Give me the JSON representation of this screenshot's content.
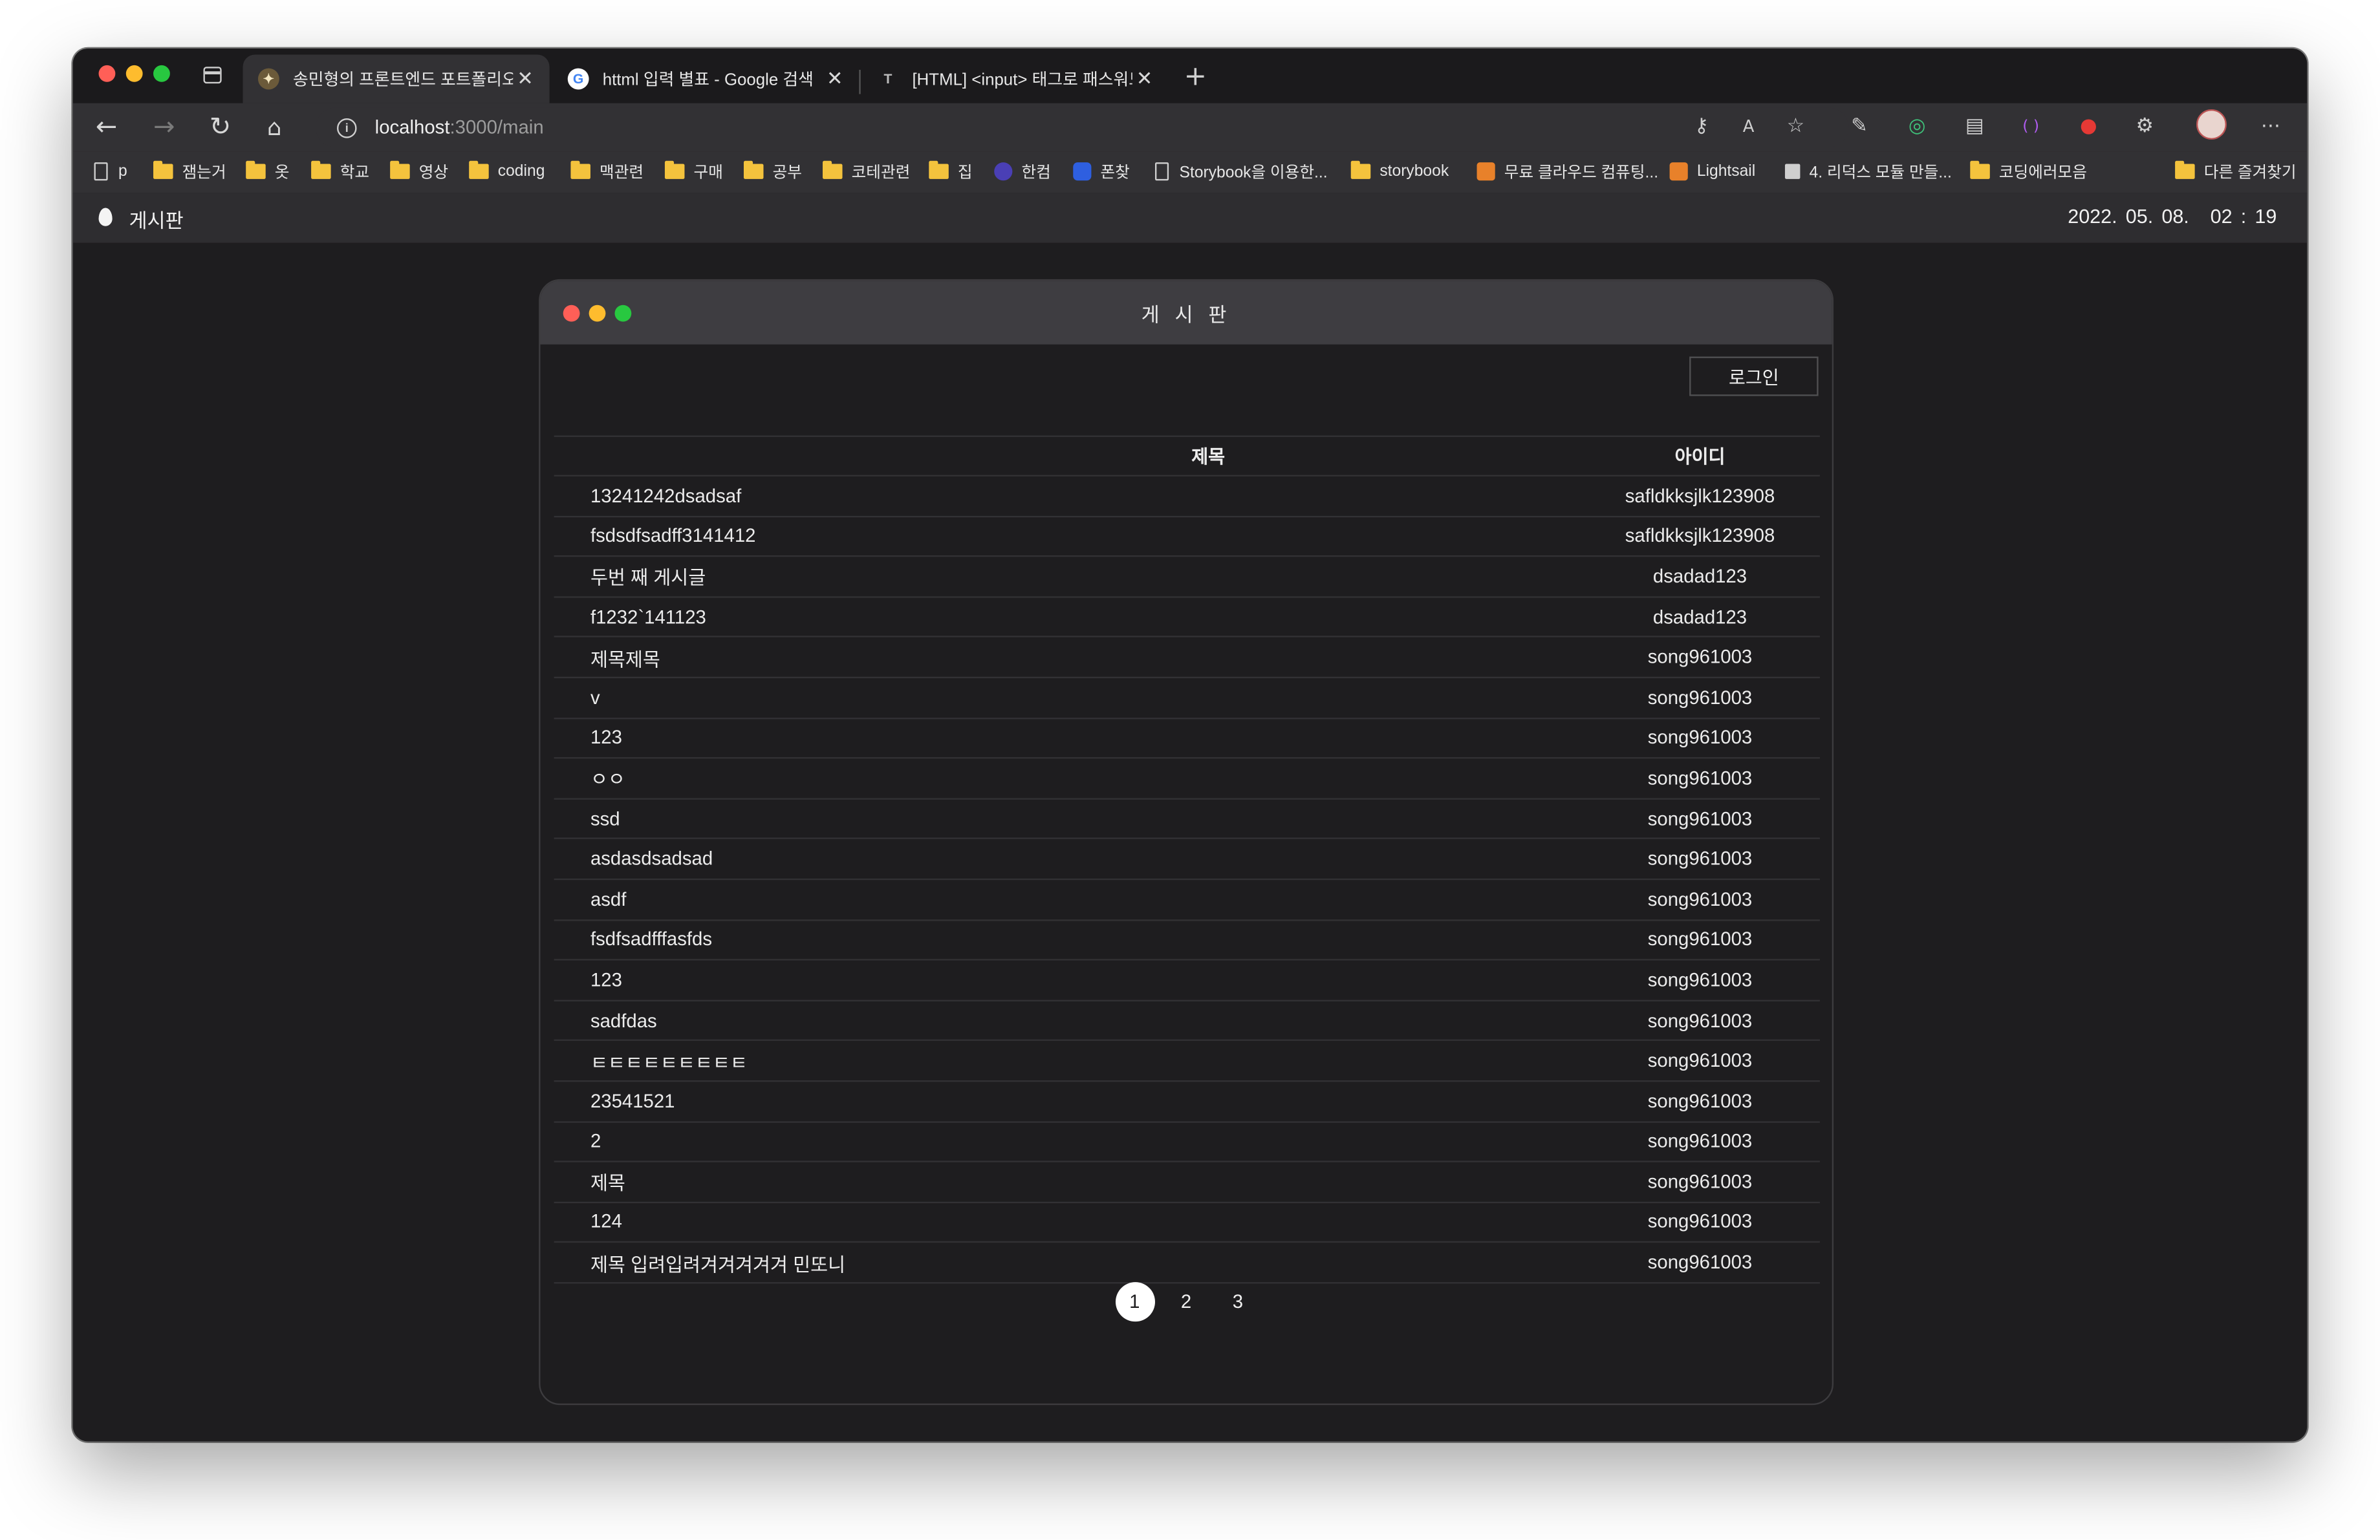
{
  "browser": {
    "tabs": [
      {
        "title": "송민형의 프론트엔드 포트폴리오",
        "active": true
      },
      {
        "title": "httml 입력 별표 - Google 검색",
        "active": false
      },
      {
        "title": "[HTML] <input> 태그로 패스워드",
        "active": false
      }
    ],
    "address": {
      "host": "localhost",
      "path": ":3000/main"
    },
    "bookmarks": [
      {
        "label": "p",
        "type": "page"
      },
      {
        "label": "잼는거",
        "type": "folder"
      },
      {
        "label": "옷",
        "type": "folder"
      },
      {
        "label": "학교",
        "type": "folder"
      },
      {
        "label": "영상",
        "type": "folder"
      },
      {
        "label": "coding",
        "type": "folder"
      },
      {
        "label": "맥관련",
        "type": "folder"
      },
      {
        "label": "구매",
        "type": "folder"
      },
      {
        "label": "공부",
        "type": "folder"
      },
      {
        "label": "코테관련",
        "type": "folder"
      },
      {
        "label": "집",
        "type": "folder"
      },
      {
        "label": "한컴",
        "type": "site"
      },
      {
        "label": "폰찾",
        "type": "site"
      },
      {
        "label": "Storybook을 이용한...",
        "type": "page"
      },
      {
        "label": "storybook",
        "type": "folder"
      },
      {
        "label": "무료 클라우드 컴퓨팅...",
        "type": "site"
      },
      {
        "label": "Lightsail",
        "type": "site"
      },
      {
        "label": "4. 리덕스 모듈 만들...",
        "type": "site"
      },
      {
        "label": "코딩에러모음",
        "type": "folder"
      }
    ],
    "other_bookmarks": "다른 즐겨찾기"
  },
  "app": {
    "title": "게시판",
    "date": "2022. 05. 08.",
    "time": "02 : 19"
  },
  "board": {
    "title": "게 시 판",
    "login_label": "로그인",
    "columns": {
      "title": "제목",
      "id": "아이디"
    },
    "rows": [
      {
        "title": "13241242dsadsaf",
        "id": "safldkksjlk123908"
      },
      {
        "title": "fsdsdfsadff3141412",
        "id": "safldkksjlk123908"
      },
      {
        "title": "두번 째 게시글",
        "id": "dsadad123"
      },
      {
        "title": "f1232`141123",
        "id": "dsadad123"
      },
      {
        "title": "제목제목",
        "id": "song961003"
      },
      {
        "title": "v",
        "id": "song961003"
      },
      {
        "title": "123",
        "id": "song961003"
      },
      {
        "title": "ㅇㅇ",
        "id": "song961003"
      },
      {
        "title": "ssd",
        "id": "song961003"
      },
      {
        "title": "asdasdsadsad",
        "id": "song961003"
      },
      {
        "title": "asdf",
        "id": "song961003"
      },
      {
        "title": "fsdfsadfffasfds",
        "id": "song961003"
      },
      {
        "title": "123",
        "id": "song961003"
      },
      {
        "title": "sadfdas",
        "id": "song961003"
      },
      {
        "title": "ㅌㅌㅌㅌㅌㅌㅌㅌㅌ",
        "id": "song961003"
      },
      {
        "title": "23541521",
        "id": "song961003"
      },
      {
        "title": "2",
        "id": "song961003"
      },
      {
        "title": "제목",
        "id": "song961003"
      },
      {
        "title": "124",
        "id": "song961003"
      },
      {
        "title": "제목 입려입려겨겨겨겨겨 민또니",
        "id": "song961003"
      }
    ],
    "pages": [
      "1",
      "2",
      "3"
    ],
    "current_page": "1"
  }
}
